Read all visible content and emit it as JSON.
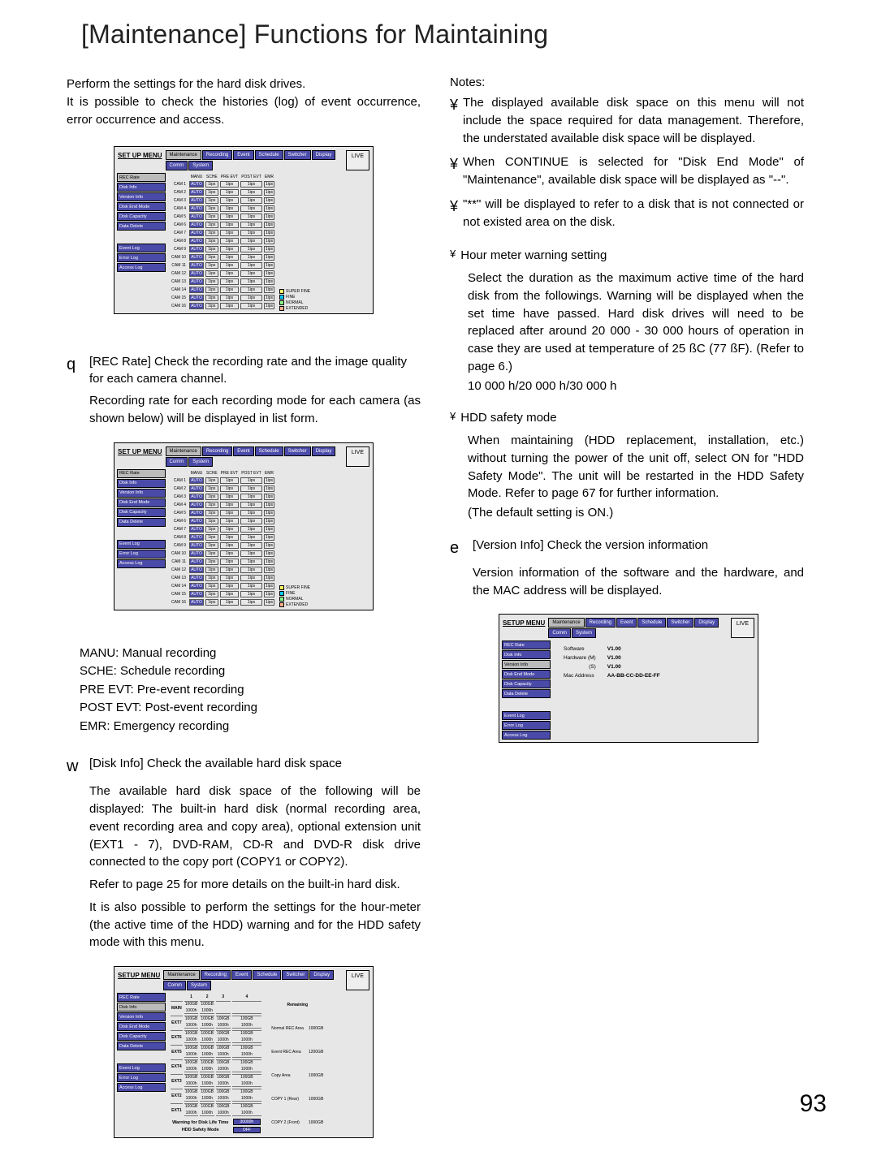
{
  "page_title": "[Maintenance] Functions for Maintaining",
  "intro_1": "Perform the settings for the hard disk drives.",
  "intro_2": "It is possible to check the histories (log) of event occurrence, error occurrence and access.",
  "sec_q_num": "q",
  "sec_q_head": "[REC Rate] Check the recording rate and the image quality for each camera channel.",
  "sec_q_body": "Recording rate for each recording mode for each camera (as shown below) will be displayed in list form.",
  "legend": {
    "manu": "MANU: Manual recording",
    "sche": "SCHE: Schedule recording",
    "pre": "PRE EVT: Pre-event recording",
    "post": "POST EVT: Post-event recording",
    "emr": "EMR: Emergency recording"
  },
  "sec_w_num": "w",
  "sec_w_head": "[Disk Info] Check the available hard disk space",
  "sec_w_body_1": "The available hard disk space of the following will be displayed: The built-in hard disk (normal recording area, event recording area and copy area), optional extension unit (EXT1 - 7), DVD-RAM, CD-R and DVD-R disk drive connected to the copy port (COPY1 or COPY2).",
  "sec_w_body_2": "Refer to page 25 for more details on the built-in hard disk.",
  "sec_w_body_3": "It is also possible to perform the settings for the hour-meter (the active time of the HDD) warning and for the HDD safety mode with this menu.",
  "notes_head": "Notes:",
  "note_1": "The displayed available disk space on this menu will not include the space required for data management. Therefore, the understated available disk space will be displayed.",
  "note_2": "When CONTINUE is selected for \"Disk End Mode\" of \"Maintenance\", available disk space will be displayed as \"--\".",
  "note_3": "\"**\" will be displayed to refer to a disk that is not connected or not existed area on the disk.",
  "hm_head": "Hour meter warning setting",
  "hm_body_1": "Select the duration as the maximum active time of the hard disk from the followings. Warning will be displayed when the set time have passed. Hard disk drives will need to be replaced after around 20 000 - 30 000 hours of operation in case they are used at temperature of 25 ßC (77 ßF). (Refer to page 6.)",
  "hm_body_2": "10 000 h/20 000 h/30 000 h",
  "hdd_head": "HDD safety mode",
  "hdd_body_1": "When maintaining (HDD replacement, installation, etc.) without turning the power of the unit off, select ON for \"HDD Safety Mode\". The unit will be restarted in the HDD Safety Mode. Refer to page 67 for further information.",
  "hdd_body_2": "(The default setting is ON.)",
  "sec_e_num": "e",
  "sec_e_head": "[Version Info] Check the version information",
  "sec_e_body": "Version information of the software and the hardware, and the MAC address will be displayed.",
  "page_number": "93",
  "menu": {
    "title": "SET UP MENU",
    "setup_menu": "SETUP MENU",
    "tabs": [
      "Maintenance",
      "Recording",
      "Event",
      "Schedule",
      "Switcher",
      "Display",
      "Comm",
      "System"
    ],
    "live": "LIVE",
    "left": [
      "REC Rate",
      "Disk Info",
      "Version Info",
      "Disk End Mode",
      "Disk Capacity",
      "Data Delete",
      "",
      "Event Log",
      "Error Log",
      "Access Log"
    ],
    "rate_cols": [
      "MANU",
      "SCHE",
      "PRE EVT",
      "POST EVT",
      "EMR"
    ],
    "cams": [
      "CAM 1",
      "CAM 2",
      "CAM 3",
      "CAM 4",
      "CAM 5",
      "CAM 6",
      "CAM 7",
      "CAM 8",
      "CAM 9",
      "CAM 10",
      "CAM 11",
      "CAM 12",
      "CAM 13",
      "CAM 14",
      "CAM 15",
      "CAM 16"
    ],
    "auto": "AUTO",
    "ips": "1ips",
    "legend_items": [
      {
        "c": "#ff6",
        "l": "SUPER FINE"
      },
      {
        "c": "#0cf",
        "l": "FINE"
      },
      {
        "c": "#8f8",
        "l": "NORMAL"
      },
      {
        "c": "#fa8",
        "l": "EXTENDED"
      }
    ]
  },
  "disk": {
    "cols": [
      "1",
      "2",
      "3",
      "4"
    ],
    "rows": [
      "MAIN",
      "EXT7",
      "EXT6",
      "EXT5",
      "EXT4",
      "EXT3",
      "EXT2",
      "EXT1"
    ],
    "g": "100GB",
    "h": "1000h",
    "rem_head": "Remaining",
    "rem": [
      [
        "Normal REC Area",
        "1000GB"
      ],
      [
        "Event REC Area",
        "1200GB"
      ],
      [
        "Copy Area",
        "1000GB"
      ],
      [
        "COPY 1 (Rear)",
        "1000GB"
      ],
      [
        "COPY 2 (Front)",
        "1000GB"
      ]
    ],
    "warn": "Warning for Disk Life Time",
    "warn_v": "30000h",
    "safety": "HDD Safety Mode",
    "off": "OFF"
  },
  "version": {
    "rows": [
      [
        "Software",
        "V1.00"
      ],
      [
        "Hardware (M)",
        "V1.00"
      ],
      [
        "(S)",
        "V1.00"
      ],
      [
        "Mac Address",
        "AA-BB-CC-DD-EE-FF"
      ]
    ]
  }
}
